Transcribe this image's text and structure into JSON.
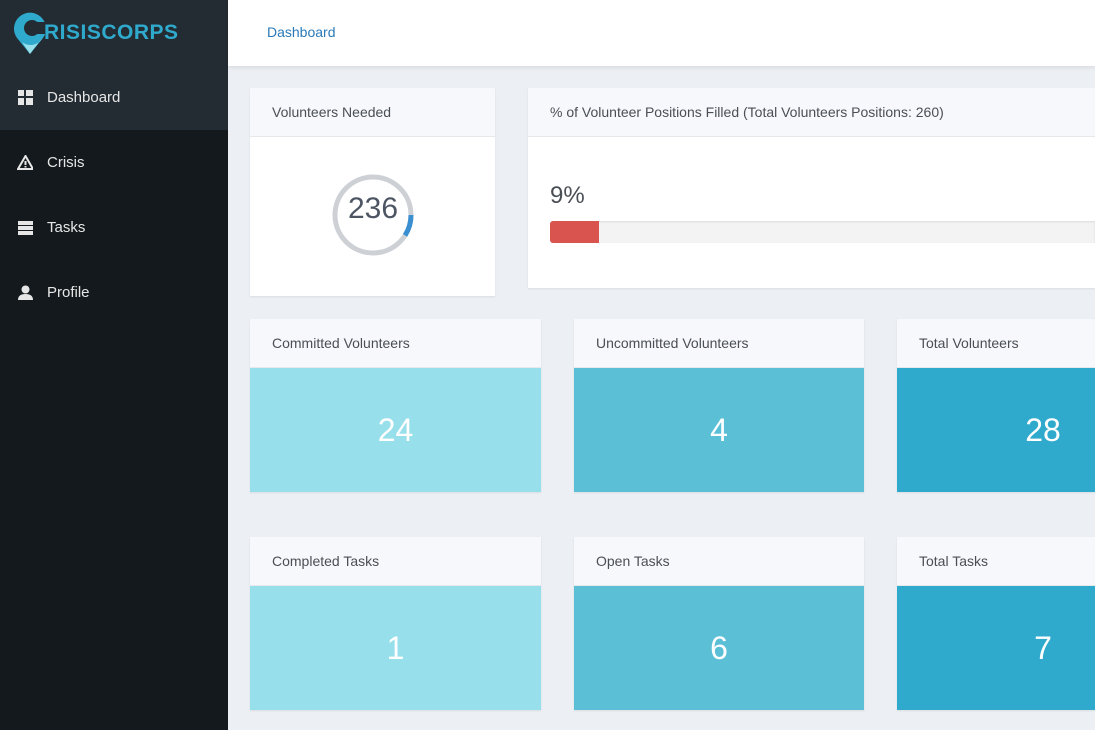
{
  "brand": {
    "name": "RISISCORPS",
    "accent": "#2fa9cc"
  },
  "sidebar": {
    "items": [
      {
        "label": "Dashboard",
        "icon": "dashboard-grid-icon",
        "active": true
      },
      {
        "label": "Crisis",
        "icon": "warning-triangle-icon"
      },
      {
        "label": "Tasks",
        "icon": "server-list-icon"
      },
      {
        "label": "Profile",
        "icon": "user-icon"
      }
    ]
  },
  "breadcrumb": "Dashboard",
  "volunteers_needed": {
    "title": "Volunteers Needed",
    "value": "236",
    "fraction_filled": 0.09
  },
  "positions": {
    "title": "% of Volunteer Positions Filled (Total Volunteers Positions: 260)",
    "percent_label": "9%",
    "percent": 9,
    "bar_color": "#d9534f"
  },
  "volunteer_stats": [
    {
      "title": "Committed Volunteers",
      "value": "24",
      "color": "#97dfea"
    },
    {
      "title": "Uncommitted Volunteers",
      "value": "4",
      "color": "#5bbfd6"
    },
    {
      "title": "Total Volunteers",
      "value": "28",
      "color": "#2fa9cc"
    }
  ],
  "task_stats": [
    {
      "title": "Completed Tasks",
      "value": "1",
      "color": "#97dfea"
    },
    {
      "title": "Open Tasks",
      "value": "6",
      "color": "#5bbfd6"
    },
    {
      "title": "Total Tasks",
      "value": "7",
      "color": "#2fa9cc"
    }
  ]
}
